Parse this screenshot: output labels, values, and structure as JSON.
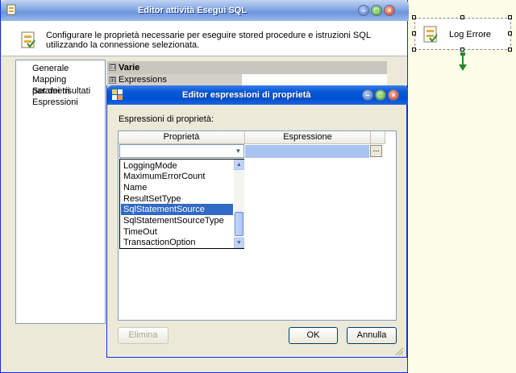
{
  "outer": {
    "title": "Editor attività Esegui SQL",
    "description": "Configurare le proprietà necessarie per eseguire stored procedure e istruzioni SQL utilizzando la connessione selezionata.",
    "nav": [
      "Generale",
      "Mapping parametri",
      "Set dei risultati",
      "Espressioni"
    ],
    "grid_category": "Varie",
    "grid_row": "Expressions",
    "expander_minus": "⊟",
    "expander_plus": "⊞"
  },
  "inner": {
    "title": "Editor espressioni di proprietà",
    "section_label": "Espressioni di proprietà:",
    "col_property": "Proprietà",
    "col_expression": "Espressione",
    "ellipsis": "...",
    "dropdown_items": [
      "LoggingMode",
      "MaximumErrorCount",
      "Name",
      "ResultSetType",
      "SqlStatementSource",
      "SqlStatementSourceType",
      "TimeOut",
      "TransactionOption"
    ],
    "selected_item": "SqlStatementSource",
    "buttons": {
      "delete": "Elimina",
      "ok": "OK",
      "cancel": "Annulla"
    }
  },
  "canvas": {
    "shape_label": "Log Errore"
  },
  "colors": {
    "selection": "#316ac5",
    "title_blue": "#0a5ad8",
    "arrow_green": "#1f8a2a"
  }
}
